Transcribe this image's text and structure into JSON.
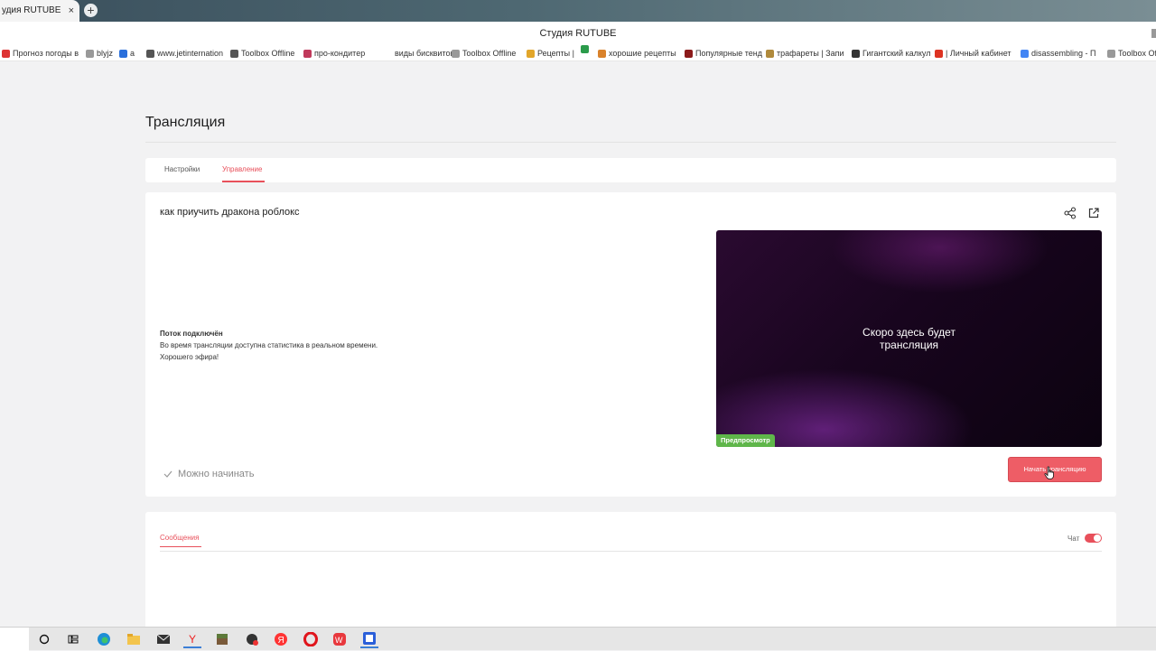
{
  "browser": {
    "tab_title": "удия RUTUBE",
    "tab_close": "×",
    "new_tab": "+",
    "window_title": "Студия RUTUBE",
    "bookmarks": [
      {
        "label": "Прогноз погоды в",
        "color": "#d33"
      },
      {
        "label": "blyjz",
        "color": "#999"
      },
      {
        "label": "a",
        "color": "#2a6fdb"
      },
      {
        "label": "www.jetinternation",
        "color": "#555"
      },
      {
        "label": "Toolbox Offline",
        "color": "#555"
      },
      {
        "label": "про-кондитер",
        "color": "#c0395b"
      },
      {
        "label": "виды бисквитов",
        "color": "#ffffff"
      },
      {
        "label": "Toolbox Offline",
        "color": "#999"
      },
      {
        "label": "Рецепты |",
        "color": "#e2a62a"
      },
      {
        "label": "",
        "color": "#2b9b4b"
      },
      {
        "label": "хорошие рецепты",
        "color": "#d9822b"
      },
      {
        "label": "Популярные тенд",
        "color": "#8b1a1a"
      },
      {
        "label": "трафареты | Запи",
        "color": "#b08a3c"
      },
      {
        "label": "Гигантский калкул",
        "color": "#333"
      },
      {
        "label": "| Личный кабинет",
        "color": "#d32"
      },
      {
        "label": "disassembling - П",
        "color": "#4285f4"
      },
      {
        "label": "Toolbox Offl",
        "color": "#999"
      }
    ]
  },
  "page": {
    "title": "Трансляция",
    "tabs": [
      {
        "label": "Настройки",
        "active": false
      },
      {
        "label": "Управление",
        "active": true
      }
    ]
  },
  "stream": {
    "title": "как приучить дракона роблокс",
    "status_heading": "Поток подключён",
    "status_line1": "Во время трансляции доступна статистика в реальном времени.",
    "status_line2": "Хорошего эфира!",
    "preview_line1": "Скоро здесь будет",
    "preview_line2": "трансляция",
    "preview_badge": "Предпросмотр",
    "ready_label": "Можно начинать",
    "start_button": "Начать трансляцию"
  },
  "messages": {
    "tab_label": "Сообщения",
    "chat_label": "Чат",
    "chat_enabled": true
  },
  "colors": {
    "accent": "#e8505b",
    "preview_badge": "#5fb64a"
  },
  "taskbar": {
    "icons": [
      "search-icon",
      "task-view-icon",
      "edge-icon",
      "file-explorer-icon",
      "mail-icon",
      "yandex-browser-icon",
      "minecraft-icon",
      "app-icon",
      "yandex-icon",
      "opera-icon",
      "wps-office-icon",
      "active-app-icon"
    ]
  }
}
